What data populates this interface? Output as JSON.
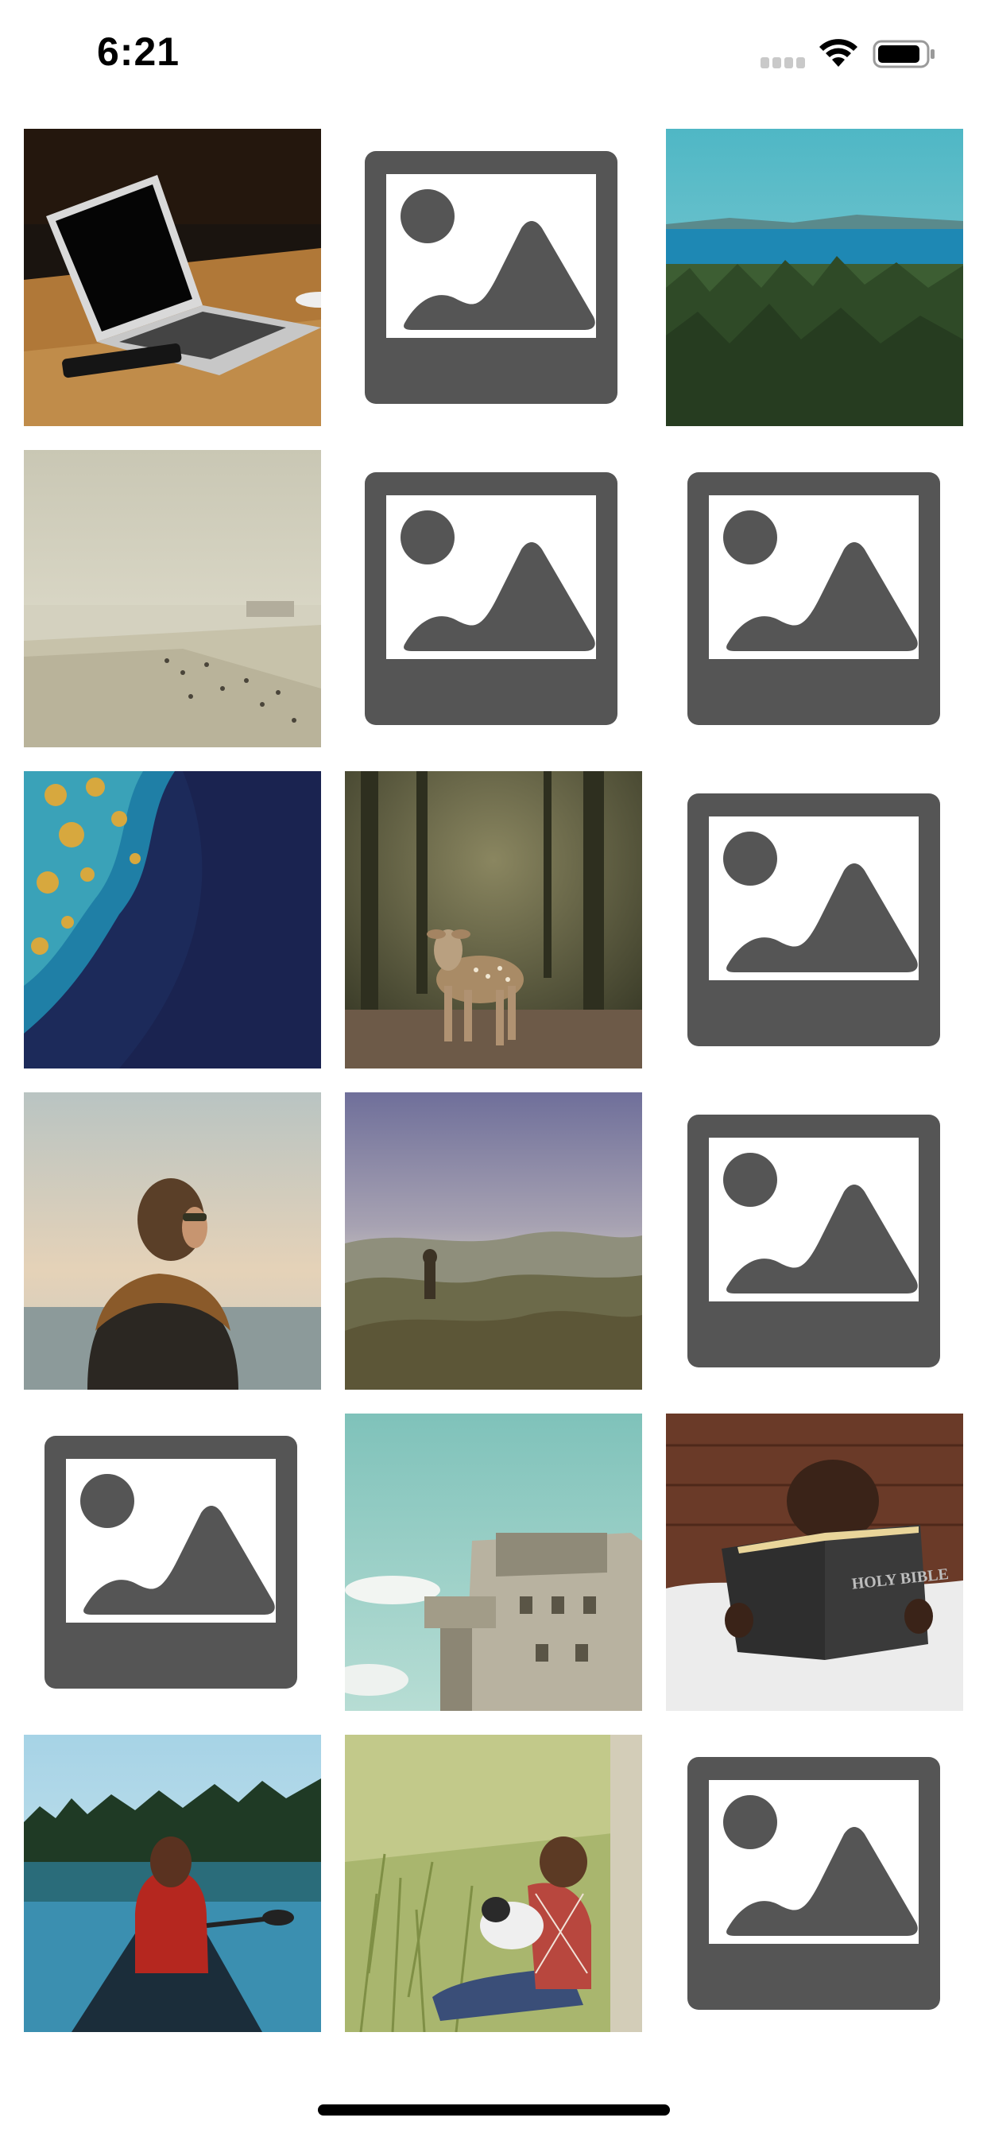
{
  "status_bar": {
    "time": "6:21",
    "icons": [
      "cellular-signal-icon",
      "wifi-icon",
      "battery-icon"
    ]
  },
  "gallery": {
    "columns": 3,
    "rows": 6,
    "items": [
      {
        "kind": "photo",
        "subject": "laptop-on-desk"
      },
      {
        "kind": "placeholder"
      },
      {
        "kind": "photo",
        "subject": "lake-and-forest"
      },
      {
        "kind": "photo",
        "subject": "foggy-beach"
      },
      {
        "kind": "placeholder"
      },
      {
        "kind": "placeholder"
      },
      {
        "kind": "photo",
        "subject": "aerial-ocean"
      },
      {
        "kind": "photo",
        "subject": "deer-in-forest"
      },
      {
        "kind": "placeholder"
      },
      {
        "kind": "photo",
        "subject": "woman-by-sea"
      },
      {
        "kind": "photo",
        "subject": "misty-cliff"
      },
      {
        "kind": "placeholder"
      },
      {
        "kind": "placeholder"
      },
      {
        "kind": "photo",
        "subject": "concrete-bunker"
      },
      {
        "kind": "photo",
        "subject": "boy-reading-bible",
        "printed_text": "HOLY BIBLE"
      },
      {
        "kind": "photo",
        "subject": "woman-in-canoe"
      },
      {
        "kind": "photo",
        "subject": "man-with-dog-in-grass"
      },
      {
        "kind": "placeholder"
      }
    ]
  },
  "colors": {
    "background": "#ffffff",
    "placeholder_frame": "#555555",
    "placeholder_inner": "#ffffff"
  }
}
